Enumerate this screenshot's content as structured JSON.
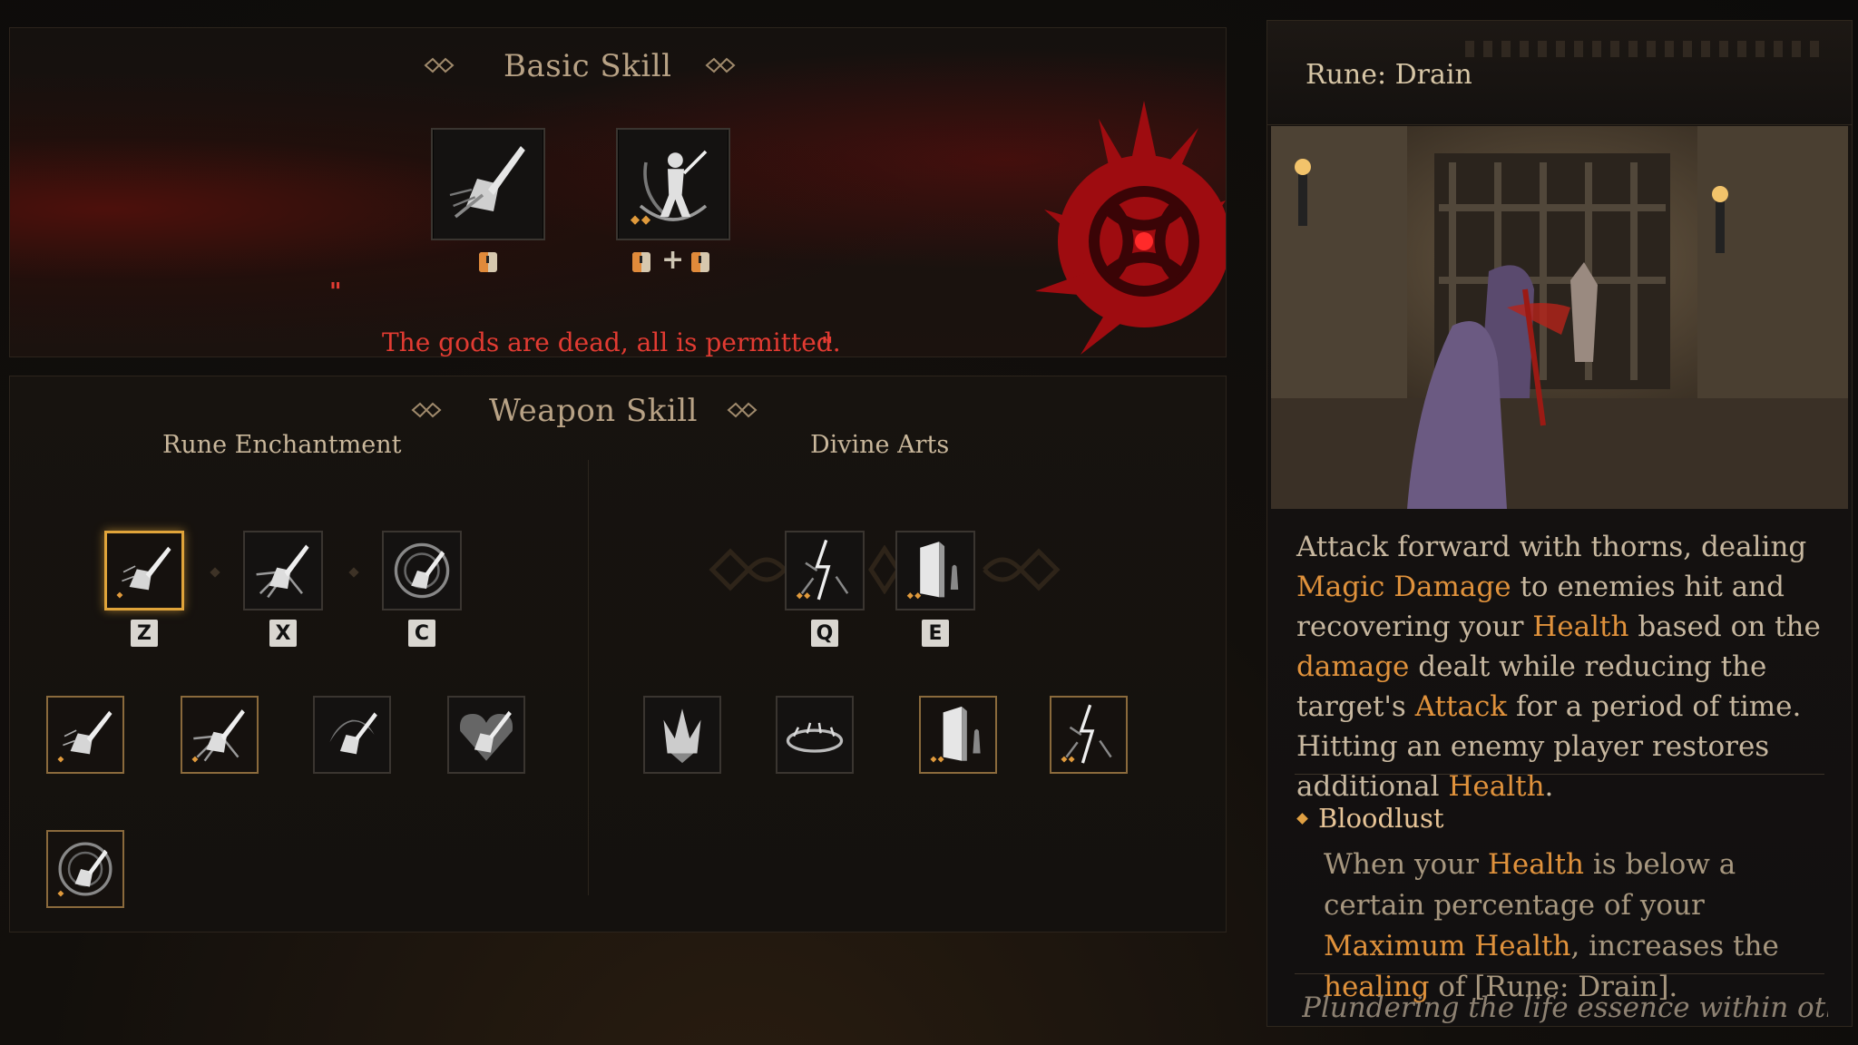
{
  "basic_skill": {
    "title": "Basic Skill",
    "quote": "The gods are dead, all is permitted."
  },
  "weapon_skill": {
    "title": "Weapon Skill",
    "rune_enchantment": {
      "title": "Rune Enchantment",
      "keys": [
        "Z",
        "X",
        "C"
      ]
    },
    "divine_arts": {
      "title": "Divine Arts",
      "keys": [
        "Q",
        "E"
      ]
    }
  },
  "detail": {
    "title": "Rune: Drain",
    "description_parts": [
      "Attack forward with thorns, dealing ",
      "Magic Damage",
      " to enemies hit and recovering your ",
      "Health",
      " based on the ",
      "damage",
      " dealt while reducing the target's ",
      "Attack",
      " for a period of time. Hitting an enemy player restores additional ",
      "Health",
      "."
    ],
    "bloodlust_title": "Bloodlust",
    "bloodlust_parts": [
      "When your ",
      "Health",
      " is below a certain percentage of your ",
      "Maximum Health",
      ", increases the ",
      "healing",
      " of [Rune: Drain]."
    ],
    "lore": "Plundering the life essence within others"
  },
  "colors": {
    "accent_orange": "#e0923c",
    "quote_red": "#e23b32",
    "selected_border": "#e0a43a"
  }
}
